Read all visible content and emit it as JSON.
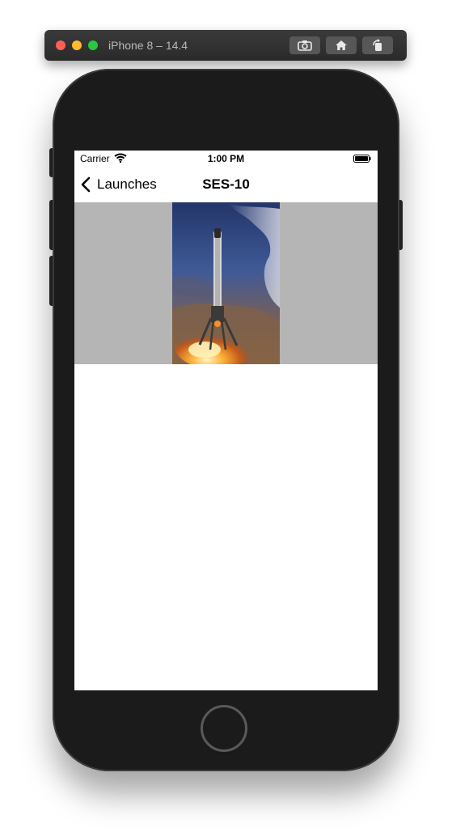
{
  "simulator": {
    "device_title": "iPhone 8 – 14.4",
    "buttons": [
      {
        "name": "screenshot",
        "icon": "camera-icon"
      },
      {
        "name": "home",
        "icon": "home-icon"
      },
      {
        "name": "rotate",
        "icon": "rotate-icon"
      }
    ]
  },
  "status_bar": {
    "carrier": "Carrier",
    "time": "1:00 PM",
    "icons": [
      "wifi-icon",
      "battery-icon"
    ]
  },
  "nav": {
    "back_label": "Launches",
    "title": "SES-10"
  },
  "colors": {
    "image_background": "#b5b5b5",
    "device_body": "#1b1b1b"
  },
  "content": {
    "image": "rocket-landing-photo"
  }
}
